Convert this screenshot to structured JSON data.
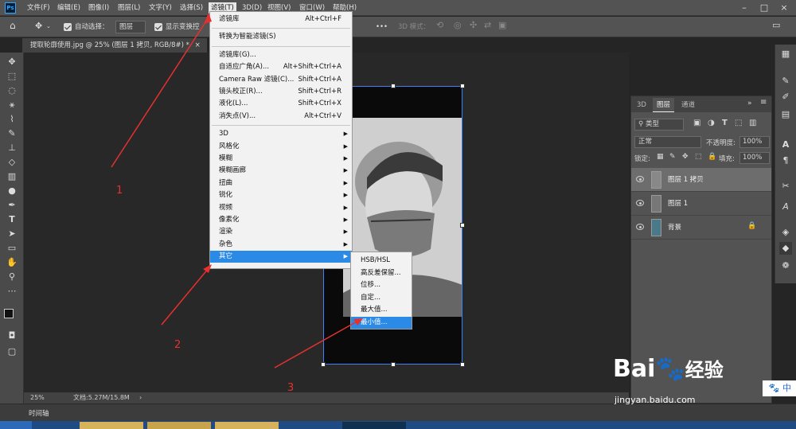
{
  "app": {
    "logo": "Ps"
  },
  "menubar": {
    "items": [
      "文件(F)",
      "编辑(E)",
      "图像(I)",
      "图层(L)",
      "文字(Y)",
      "选择(S)",
      "滤镜(T)",
      "3D(D)",
      "视图(V)",
      "窗口(W)",
      "帮助(H)"
    ],
    "active_index": 6,
    "window_controls": [
      "–",
      "□",
      "×"
    ]
  },
  "options": {
    "auto_select_label": "自动选择：",
    "auto_select_value": "图层",
    "show_transform_label": "显示变换控",
    "more": "•••",
    "mode_3d": "3D 模式："
  },
  "document": {
    "tab_title": "提取轮廓使用.jpg @ 25% (图层 1 拷贝, RGB/8#) *",
    "tab_close": "×"
  },
  "status": {
    "zoom": "25%",
    "doc_size": "文档:5.27M/15.8M",
    "arrow": "›"
  },
  "timeline": {
    "label": "时间轴"
  },
  "filter_menu": {
    "items": [
      {
        "label": "滤镜库",
        "shortcut": "Alt+Ctrl+F",
        "submenu": false
      },
      {
        "sep": true
      },
      {
        "label": "转换为智能滤镜(S)",
        "shortcut": "",
        "submenu": false
      },
      {
        "sep": true
      },
      {
        "label": "滤镜库(G)...",
        "shortcut": "",
        "submenu": false
      },
      {
        "label": "自适应广角(A)...",
        "shortcut": "Alt+Shift+Ctrl+A",
        "submenu": false
      },
      {
        "label": "Camera Raw 滤镜(C)...",
        "shortcut": "Shift+Ctrl+A",
        "submenu": false
      },
      {
        "label": "镜头校正(R)...",
        "shortcut": "Shift+Ctrl+R",
        "submenu": false
      },
      {
        "label": "液化(L)...",
        "shortcut": "Shift+Ctrl+X",
        "submenu": false
      },
      {
        "label": "消失点(V)...",
        "shortcut": "Alt+Ctrl+V",
        "submenu": false
      },
      {
        "sep": true
      },
      {
        "label": "3D",
        "shortcut": "",
        "submenu": true
      },
      {
        "label": "风格化",
        "shortcut": "",
        "submenu": true
      },
      {
        "label": "模糊",
        "shortcut": "",
        "submenu": true
      },
      {
        "label": "模糊画廊",
        "shortcut": "",
        "submenu": true
      },
      {
        "label": "扭曲",
        "shortcut": "",
        "submenu": true
      },
      {
        "label": "锐化",
        "shortcut": "",
        "submenu": true
      },
      {
        "label": "视频",
        "shortcut": "",
        "submenu": true
      },
      {
        "label": "像素化",
        "shortcut": "",
        "submenu": true
      },
      {
        "label": "渲染",
        "shortcut": "",
        "submenu": true
      },
      {
        "label": "杂色",
        "shortcut": "",
        "submenu": true
      },
      {
        "label": "其它",
        "shortcut": "",
        "submenu": true,
        "highlighted": true
      }
    ]
  },
  "other_submenu": {
    "items": [
      {
        "label": "HSB/HSL"
      },
      {
        "label": "高反差保留..."
      },
      {
        "label": "位移..."
      },
      {
        "label": "自定..."
      },
      {
        "label": "最大值..."
      },
      {
        "label": "最小值...",
        "highlighted": true
      }
    ]
  },
  "layers_panel": {
    "tabs": [
      "3D",
      "图层",
      "通道"
    ],
    "active_tab": 1,
    "kind_filter": "类型",
    "blend_mode": "正常",
    "opacity_label": "不透明度:",
    "opacity_value": "100%",
    "lock_label": "锁定:",
    "fill_label": "填充:",
    "fill_value": "100%",
    "layers": [
      {
        "name": "图层 1 拷贝",
        "selected": true,
        "locked": false
      },
      {
        "name": "图层 1",
        "selected": false,
        "locked": false
      },
      {
        "name": "背景",
        "selected": false,
        "locked": true
      }
    ]
  },
  "annotations": {
    "labels": [
      "1",
      "2",
      "3"
    ],
    "color": "#e63030"
  },
  "watermark": {
    "brand": "Bai",
    "brand2": "经验",
    "url": "jingyan.baidu.com",
    "ime": "中"
  },
  "colors": {
    "highlight": "#2b8ae5",
    "panel": "#535353",
    "canvas": "#282828"
  }
}
